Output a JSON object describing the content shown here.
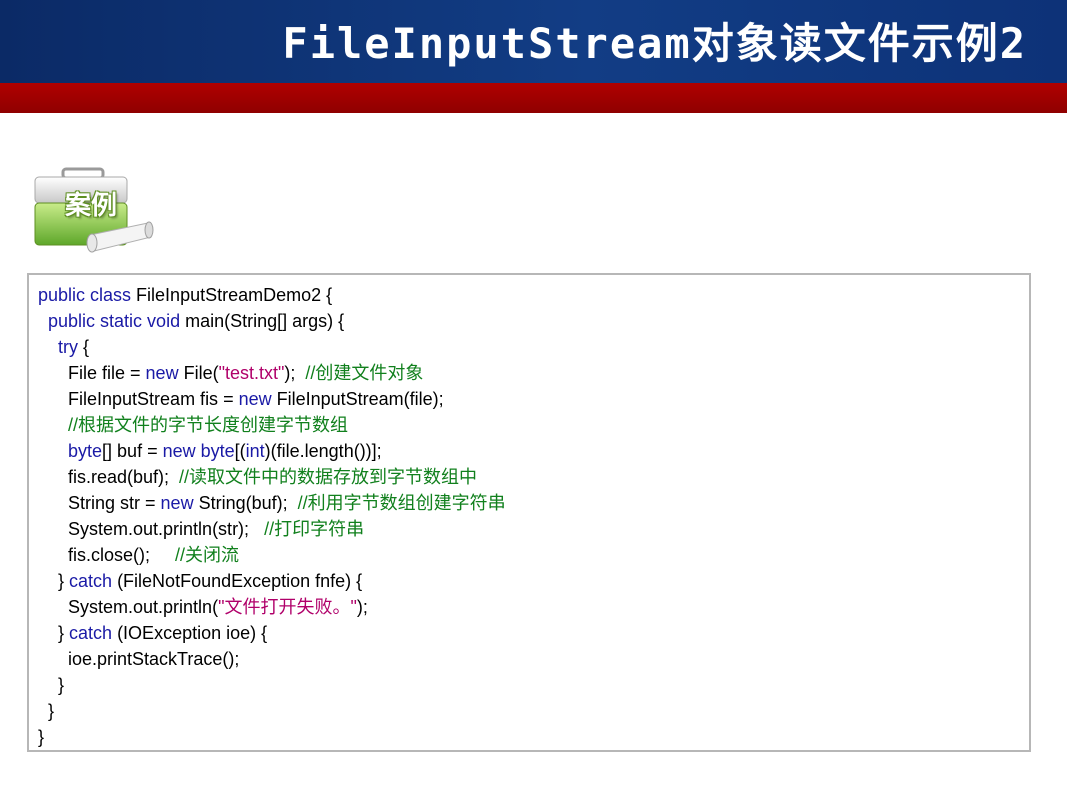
{
  "slide": {
    "title": "FileInputStream对象读文件示例2",
    "case_label": "案例"
  },
  "colors": {
    "header_blue": "#123d85",
    "red_bar": "#9e0000",
    "keyword": "#1a1aa6",
    "string": "#b0006a",
    "comment": "#11801d"
  },
  "code": [
    [
      {
        "t": "public class",
        "k": "kw"
      },
      {
        "t": " FileInputStreamDemo2 {",
        "k": "pl"
      }
    ],
    [
      {
        "t": "  ",
        "k": "pl"
      },
      {
        "t": "public static void",
        "k": "kw"
      },
      {
        "t": " main(String[] args) {",
        "k": "pl"
      }
    ],
    [
      {
        "t": "    ",
        "k": "pl"
      },
      {
        "t": "try",
        "k": "kw"
      },
      {
        "t": " {",
        "k": "pl"
      }
    ],
    [
      {
        "t": "      File file = ",
        "k": "pl"
      },
      {
        "t": "new",
        "k": "kw"
      },
      {
        "t": " File(",
        "k": "pl"
      },
      {
        "t": "\"test.txt\"",
        "k": "str"
      },
      {
        "t": ");  ",
        "k": "pl"
      },
      {
        "t": "//创建文件对象",
        "k": "cm"
      }
    ],
    [
      {
        "t": "      FileInputStream fis = ",
        "k": "pl"
      },
      {
        "t": "new",
        "k": "kw"
      },
      {
        "t": " FileInputStream(file);",
        "k": "pl"
      }
    ],
    [
      {
        "t": "      ",
        "k": "pl"
      },
      {
        "t": "//根据文件的字节长度创建字节数组",
        "k": "cm"
      }
    ],
    [
      {
        "t": "      ",
        "k": "pl"
      },
      {
        "t": "byte",
        "k": "kw"
      },
      {
        "t": "[] buf = ",
        "k": "pl"
      },
      {
        "t": "new byte",
        "k": "kw"
      },
      {
        "t": "[(",
        "k": "pl"
      },
      {
        "t": "int",
        "k": "kw"
      },
      {
        "t": ")(file.length())];",
        "k": "pl"
      }
    ],
    [
      {
        "t": "      fis.read(buf);  ",
        "k": "pl"
      },
      {
        "t": "//读取文件中的数据存放到字节数组中",
        "k": "cm"
      }
    ],
    [
      {
        "t": "      String str = ",
        "k": "pl"
      },
      {
        "t": "new",
        "k": "kw"
      },
      {
        "t": " String(buf);  ",
        "k": "pl"
      },
      {
        "t": "//利用字节数组创建字符串",
        "k": "cm"
      }
    ],
    [
      {
        "t": "      System.out.println(str);   ",
        "k": "pl"
      },
      {
        "t": "//打印字符串",
        "k": "cm"
      }
    ],
    [
      {
        "t": "      fis.close();     ",
        "k": "pl"
      },
      {
        "t": "//关闭流",
        "k": "cm"
      }
    ],
    [
      {
        "t": "    } ",
        "k": "pl"
      },
      {
        "t": "catch",
        "k": "kw"
      },
      {
        "t": " (FileNotFoundException fnfe) {",
        "k": "pl"
      }
    ],
    [
      {
        "t": "      System.out.println(",
        "k": "pl"
      },
      {
        "t": "\"文件打开失败。\"",
        "k": "str"
      },
      {
        "t": ");",
        "k": "pl"
      }
    ],
    [
      {
        "t": "    } ",
        "k": "pl"
      },
      {
        "t": "catch",
        "k": "kw"
      },
      {
        "t": " (IOException ioe) {",
        "k": "pl"
      }
    ],
    [
      {
        "t": "      ioe.printStackTrace();",
        "k": "pl"
      }
    ],
    [
      {
        "t": "    }",
        "k": "pl"
      }
    ],
    [
      {
        "t": "  }",
        "k": "pl"
      }
    ],
    [
      {
        "t": "}",
        "k": "pl"
      }
    ]
  ]
}
